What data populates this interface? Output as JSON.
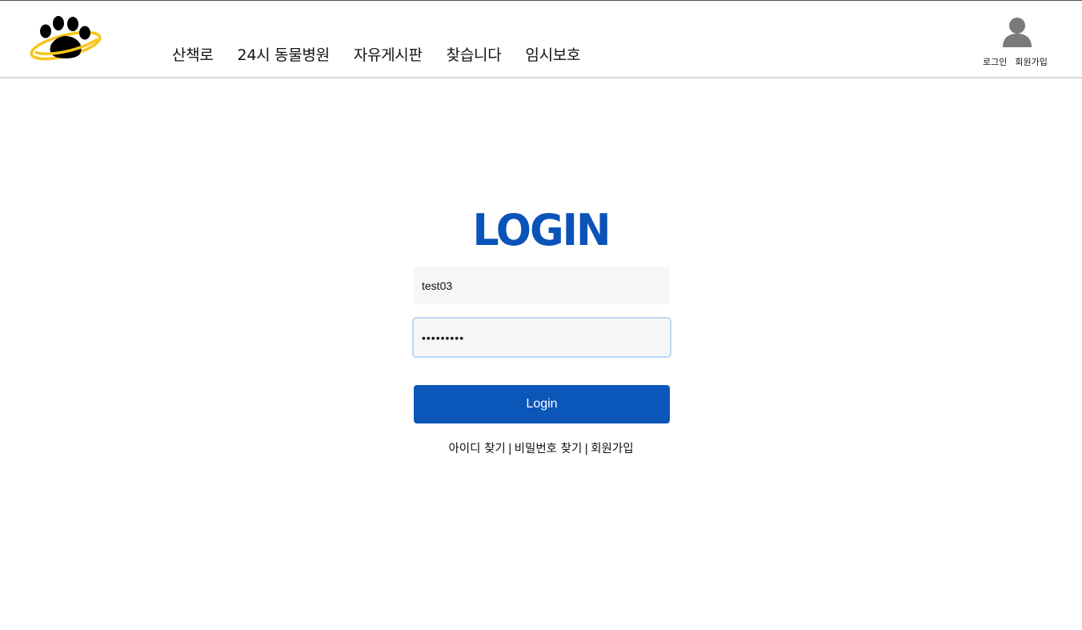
{
  "header": {
    "nav": [
      "산책로",
      "24시 동물병원",
      "자유게시판",
      "찾습니다",
      "임시보호"
    ],
    "user": {
      "login_label": "로그인",
      "signup_label": "회원가입"
    }
  },
  "login": {
    "title": "LOGIN",
    "id_value": "test03",
    "password_value": "•••••••••",
    "button_label": "Login",
    "links": {
      "find_id": "아이디 찾기",
      "find_password": "비밀번호 찾기",
      "signup": "회원가입",
      "separator": "|"
    }
  },
  "colors": {
    "brand_blue": "#0a57b9",
    "logo_ring": "#f5c518",
    "user_icon": "#7a7a7a"
  },
  "icons": {
    "logo": "paw-with-ring-logo",
    "user": "user-silhouette-icon"
  }
}
